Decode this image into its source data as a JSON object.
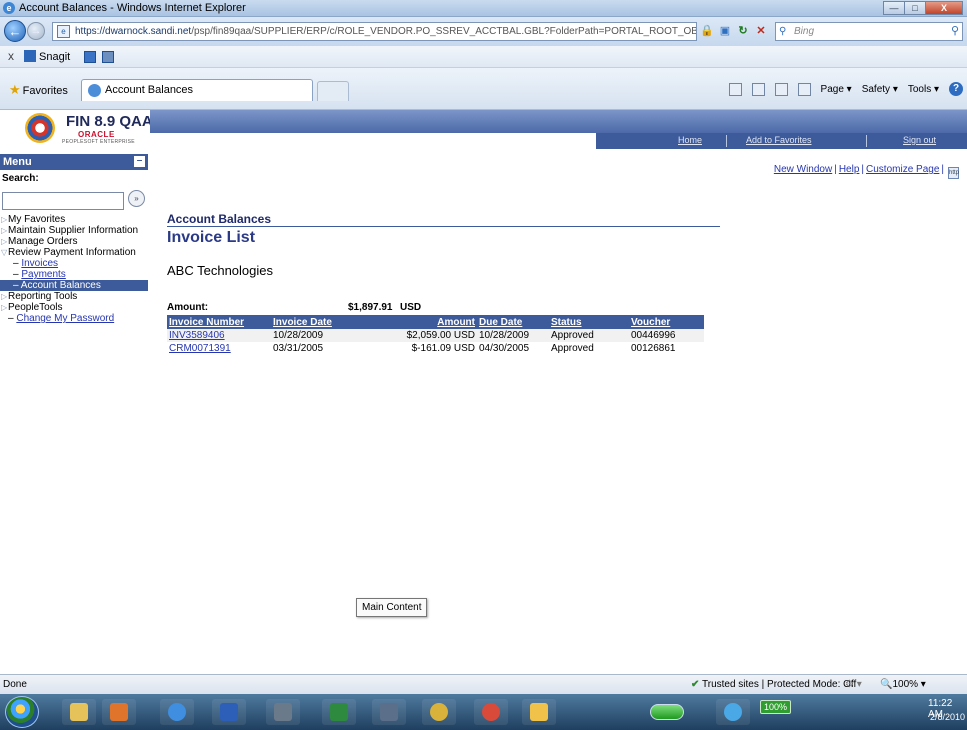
{
  "window": {
    "title": "Account Balances - Windows Internet Explorer",
    "url_host": "https://dwarnock.sandi.net",
    "url_path": "/psp/fin89qaa/SUPPLIER/ERP/c/ROLE_VENDOR.PO_SSREV_ACCTBAL.GBL?FolderPath=PORTAL_ROOT_OBJECT.EP...",
    "search_placeholder": "Bing",
    "controls": {
      "minimize": "—",
      "maximize": "□",
      "close": "X"
    }
  },
  "linksbar": {
    "close": "x",
    "snagit": "Snagit"
  },
  "favbar": {
    "favorites": "Favorites",
    "tab_title": "Account Balances",
    "commands": [
      "Page ▾",
      "Safety ▾",
      "Tools ▾"
    ]
  },
  "peoplesoft": {
    "product": "FIN 8.9 QAA",
    "oracle": "ORACLE",
    "enterprise": "PEOPLESOFT ENTERPRISE",
    "nav": [
      "Home",
      "Add to Favorites",
      "Sign out"
    ]
  },
  "menu": {
    "title": "Menu",
    "search_label": "Search:",
    "search_go": "»",
    "items": [
      {
        "label": "My Favorites",
        "kind": "folder"
      },
      {
        "label": "Maintain Supplier Information",
        "kind": "folder"
      },
      {
        "label": "Manage Orders",
        "kind": "folder"
      },
      {
        "label": "Review Payment Information",
        "kind": "open"
      },
      {
        "label": "Invoices",
        "kind": "sub"
      },
      {
        "label": "Payments",
        "kind": "sub"
      },
      {
        "label": "Account Balances",
        "kind": "active"
      },
      {
        "label": "Reporting Tools",
        "kind": "folder"
      },
      {
        "label": "PeopleTools",
        "kind": "folder"
      },
      {
        "label": "Change My Password",
        "kind": "link"
      }
    ]
  },
  "page_links": {
    "new_window": "New Window",
    "help": "Help",
    "customize": "Customize Page",
    "new_icon": "http"
  },
  "content": {
    "section": "Account Balances",
    "title": "Invoice List",
    "company": "ABC Technologies",
    "amount_label": "Amount:",
    "amount_value": "$1,897.91",
    "amount_currency": "USD",
    "columns": [
      "Invoice Number",
      "Invoice Date",
      "Amount",
      "Due Date",
      "Status",
      "Voucher"
    ],
    "rows": [
      [
        "INV3589406",
        "10/28/2009",
        "$2,059.00 USD",
        "10/28/2009",
        "Approved",
        "00446996"
      ],
      [
        "CRM0071391",
        "03/31/2005",
        "$-161.09 USD",
        "04/30/2005",
        "Approved",
        "00126861"
      ]
    ]
  },
  "tooltip": "Main Content",
  "statusbar": {
    "status": "Done",
    "zone": "Trusted sites | Protected Mode: Off",
    "zoom": "100%"
  },
  "taskbar": {
    "battery": "100%",
    "time": "11:22 AM",
    "date": "2/8/2010"
  }
}
